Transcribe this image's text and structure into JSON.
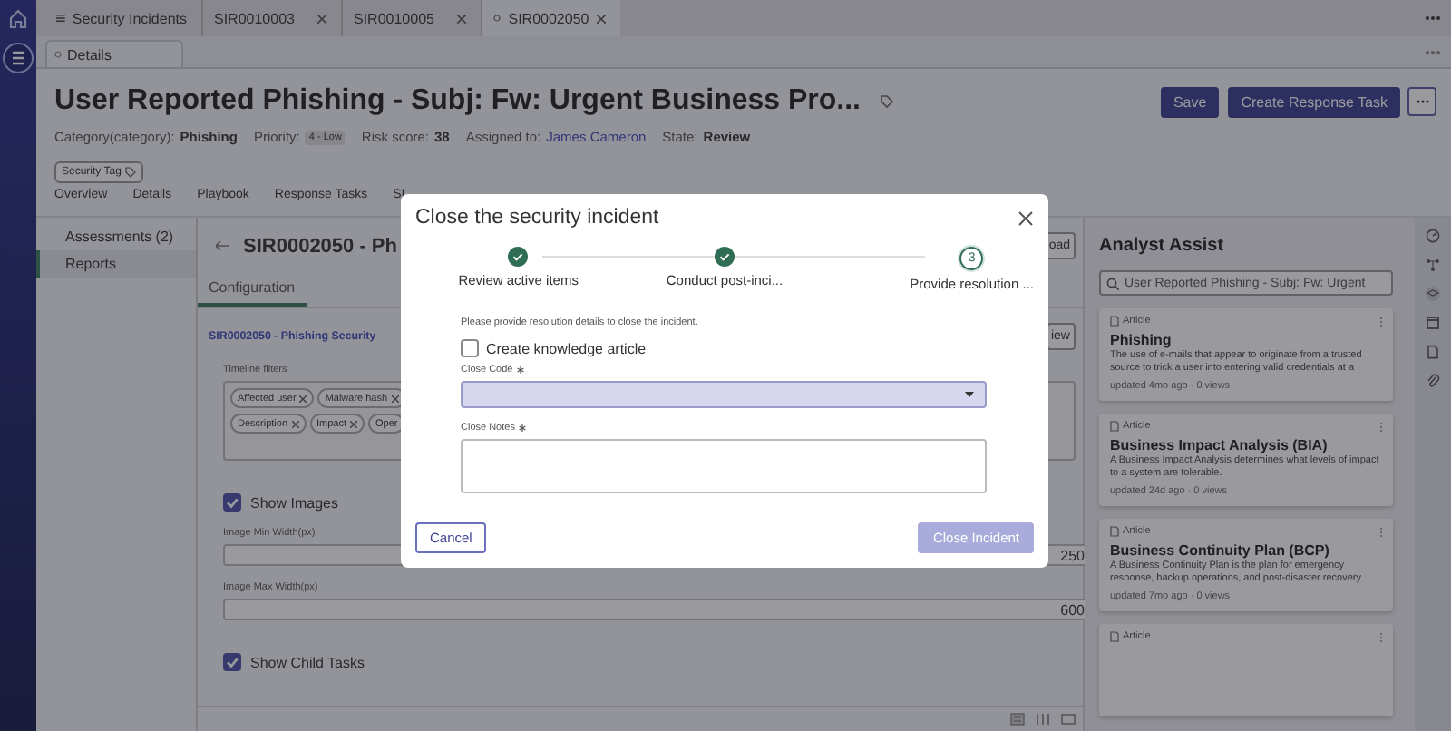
{
  "tabs": [
    {
      "label": "Security Incidents",
      "kind": "list",
      "selected": false
    },
    {
      "label": "SIR0010003",
      "kind": "record",
      "selected": false
    },
    {
      "label": "SIR0010005",
      "kind": "record",
      "selected": false
    },
    {
      "label": "SIR0002050",
      "kind": "record",
      "selected": true
    }
  ],
  "subtabs": [
    {
      "label": "Details",
      "selected": true
    }
  ],
  "record": {
    "title": "User Reported Phishing - Subj: Fw: Urgent Business Pro...",
    "fields": [
      {
        "label": "Category(category):",
        "value": "Phishing",
        "kind": "bold"
      },
      {
        "label": "Priority:",
        "value": "4 - Low",
        "kind": "badge"
      },
      {
        "label": "Risk score:",
        "value": "38",
        "kind": "bold"
      },
      {
        "label": "Assigned to:",
        "value": "James Cameron",
        "kind": "link"
      },
      {
        "label": "State:",
        "value": "Review",
        "kind": "bold"
      }
    ],
    "tag": "Security Tag",
    "buttons": [
      {
        "label": "Save"
      },
      {
        "label": "Create Response Task"
      }
    ]
  },
  "section_tabs": [
    {
      "label": "Overview"
    },
    {
      "label": "Details"
    },
    {
      "label": "Playbook"
    },
    {
      "label": "Response Tasks"
    },
    {
      "label": "SI"
    }
  ],
  "side_list": [
    {
      "label": "Assessments (2)",
      "selected": false
    },
    {
      "label": "Reports",
      "selected": true
    }
  ],
  "report": {
    "heading": "SIR0002050 - Ph",
    "heading_button": "oad",
    "tabs": [
      {
        "label": "Configuration",
        "selected": true
      }
    ],
    "link": "SIR0002050 - Phishing Security",
    "link_button": "iew",
    "filters_label": "Timeline filters",
    "chip_rows": [
      [
        "Affected user",
        "Malware hash"
      ],
      [
        "Description",
        "Impact",
        "Oper"
      ]
    ],
    "settings": [
      {
        "kind": "checkbox",
        "label": "Show Images",
        "checked": true
      },
      {
        "kind": "number",
        "label": "Image Min Width(px)",
        "value": "250"
      },
      {
        "kind": "number",
        "label": "Image Max Width(px)",
        "value": "600"
      },
      {
        "kind": "checkbox",
        "label": "Show Child Tasks",
        "checked": true
      }
    ]
  },
  "assist": {
    "title": "Analyst Assist",
    "search": "User Reported Phishing - Subj: Fw: Urgent",
    "cards": [
      {
        "type": "Article",
        "title": "Phishing",
        "description": "The use of e-mails that appear to originate from a trusted source to trick a user into entering valid credentials at a",
        "meta": "updated 4mo ago · 0 views"
      },
      {
        "type": "Article",
        "title": "Business Impact Analysis (BIA)",
        "description": "A Business Impact Analysis determines what levels of impact to a system are tolerable.",
        "meta": "updated 24d ago · 0 views"
      },
      {
        "type": "Article",
        "title": "Business Continuity Plan (BCP)",
        "description": "A Business Continuity Plan is the plan for emergency response, backup operations, and post-disaster recovery",
        "meta": "updated 7mo ago · 0 views"
      },
      {
        "type": "Article"
      }
    ]
  },
  "dialog": {
    "title": "Close the security incident",
    "steps": [
      {
        "label": "Review active items",
        "kind": "done"
      },
      {
        "label": "Conduct post-inci...",
        "kind": "done"
      },
      {
        "label": "Provide resolution ...",
        "kind": "current",
        "number": "3"
      }
    ],
    "instruction": "Please provide resolution details to close the incident.",
    "knowledge": {
      "label": "Create knowledge article",
      "checked": false
    },
    "close_code": {
      "label": "Close Code",
      "required": true,
      "highlighted": true
    },
    "close_notes": {
      "label": "Close Notes",
      "required": true
    },
    "buttons": [
      {
        "label": "Cancel",
        "kind": "secondary",
        "disabled": false
      },
      {
        "label": "Close Incident",
        "kind": "primary",
        "disabled": true
      }
    ]
  }
}
